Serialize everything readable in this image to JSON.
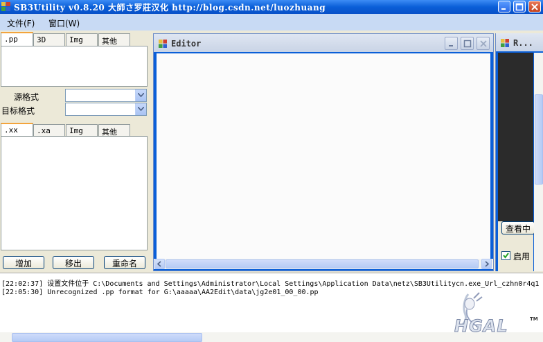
{
  "window": {
    "title": "SB3Utility v0.8.20  大師さ罗莊汉化  http://blog.csdn.net/luozhuang"
  },
  "menu": {
    "items": [
      {
        "label": "文件(F)"
      },
      {
        "label": "窗口(W)"
      }
    ]
  },
  "left": {
    "top_tabs": [
      ".pp",
      "3D",
      "Img",
      "其他"
    ],
    "source_format_label": "源格式",
    "target_format_label": "目标格式",
    "source_format_value": "",
    "target_format_value": "",
    "bottom_tabs": [
      ".xx",
      ".xa",
      "Img",
      "其他"
    ],
    "buttons": {
      "add": "增加",
      "remove": "移出",
      "rename": "重命名"
    }
  },
  "editor": {
    "title": "Editor"
  },
  "rwindow": {
    "title": "R...",
    "view_button": "查看中",
    "checkbox_label": "启用"
  },
  "log": {
    "lines": [
      "[22:02:37] 设置文件位于 C:\\Documents and Settings\\Administrator\\Local Settings\\Application Data\\netz\\SB3Utilitycn.exe_Url_czhn0r4q1",
      "[22:05:30] Unrecognized .pp format for G:\\aaaaa\\AA2Edit\\data\\jg2e01_00_00.pp"
    ]
  },
  "watermark": {
    "text": "HGAL",
    "tm": "TM"
  }
}
